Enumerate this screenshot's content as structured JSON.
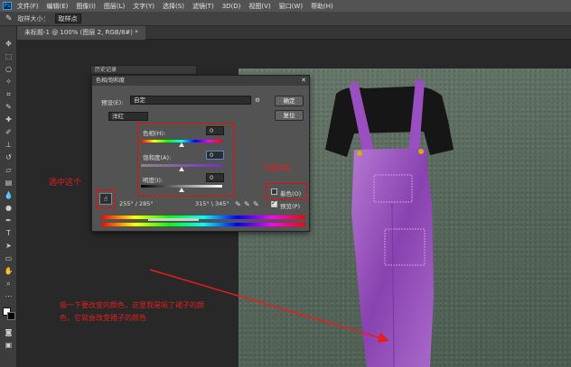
{
  "menubar": {
    "items": [
      "文件(F)",
      "编辑(E)",
      "图像(I)",
      "图层(L)",
      "文字(Y)",
      "选择(S)",
      "滤镜(T)",
      "3D(D)",
      "视图(V)",
      "窗口(W)",
      "帮助(H)"
    ]
  },
  "options": {
    "sample_size_label": "取样大小：",
    "sample_size_value": "取样点"
  },
  "document": {
    "tab_title": "未标题-1 @ 100% (图层 2, RGB/8#) *"
  },
  "panel_strip": {
    "title": "历史记录"
  },
  "dialog": {
    "title": "色相/饱和度",
    "preset_label": "预设(E):",
    "preset_value": "自定",
    "channel_value": "洋红",
    "ok_label": "确定",
    "reset_label": "复位",
    "hue_label": "色相(H):",
    "hue_value": "0",
    "saturation_label": "饱和度(A):",
    "saturation_value": "0",
    "lightness_label": "明度(I):",
    "lightness_value": "0",
    "range_left": "255° / 285°",
    "range_right": "315° \\ 345°",
    "colorize_label": "着色(O)",
    "preview_label": "预览(P)",
    "preview_checked": true
  },
  "annotations": {
    "select_this": "选中这个",
    "dont_check": "不要勾选",
    "instruction_line1": "吸一下要改变的颜色，这里我是吸了裙子的颜",
    "instruction_line2": "色，它就会改变裙子的颜色"
  },
  "colors": {
    "annotation_red": "#e61e1e",
    "dress_purple": "#9a4fc0",
    "carpet_green": "#5f6f62"
  }
}
